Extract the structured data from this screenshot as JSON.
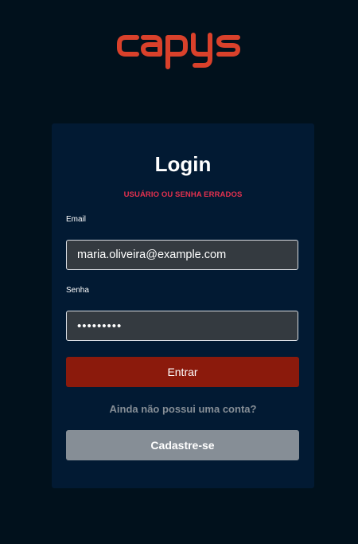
{
  "brand": {
    "name": "capys",
    "color": "#d9412b"
  },
  "login": {
    "title": "Login",
    "error_message": "USUÁRIO OU SENHA ERRADOS",
    "email_label": "Email",
    "email_value": "maria.oliveira@example.com",
    "password_label": "Senha",
    "password_value": "•••••••••",
    "submit_label": "Entrar",
    "no_account_text": "Ainda não possui uma conta?",
    "signup_label": "Cadastre-se"
  },
  "colors": {
    "background": "#01111c",
    "card": "#021a33",
    "error": "#e5314f",
    "primary_button": "#8b1a0c",
    "secondary_button": "#868e96"
  }
}
